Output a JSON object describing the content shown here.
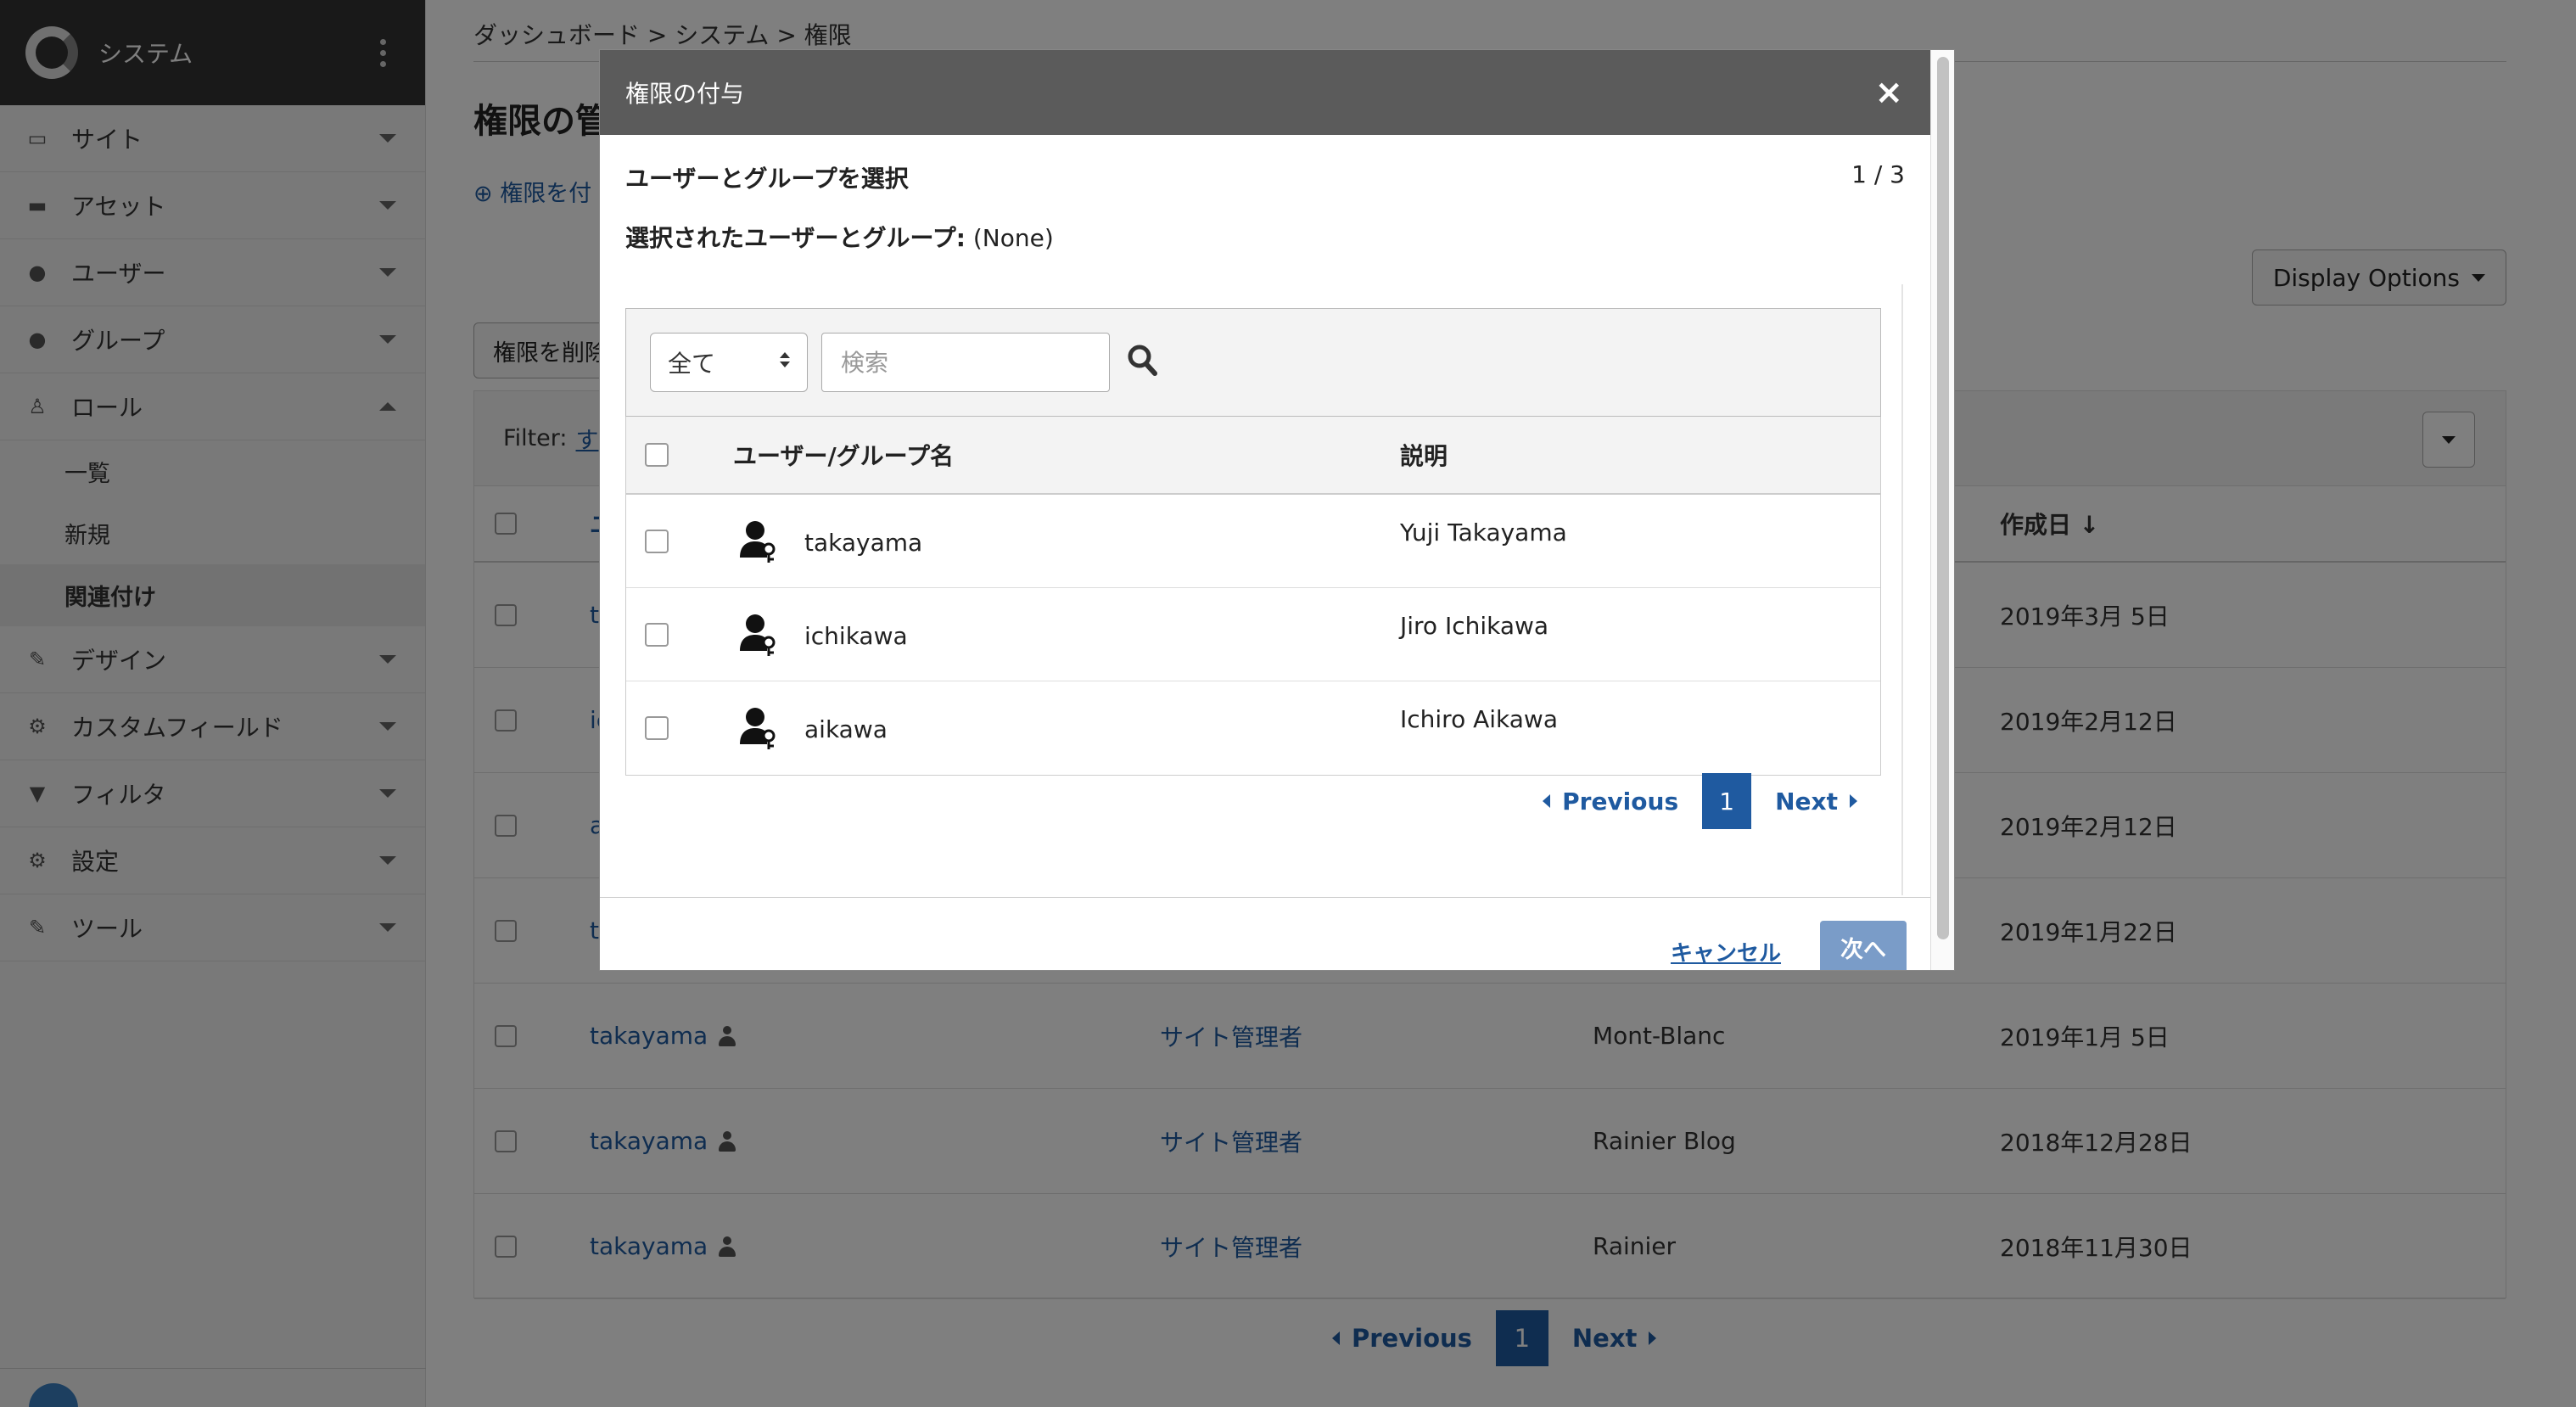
{
  "sidebar": {
    "title": "システム",
    "items": [
      {
        "label": "サイト",
        "icon": "sitemap-icon",
        "glyph": "▭"
      },
      {
        "label": "アセット",
        "icon": "briefcase-icon",
        "glyph": "▬"
      },
      {
        "label": "ユーザー",
        "icon": "user-icon",
        "glyph": "●"
      },
      {
        "label": "グループ",
        "icon": "users-icon",
        "glyph": "●"
      },
      {
        "label": "ロール",
        "icon": "sitemap-tree-icon",
        "glyph": "♙"
      },
      {
        "label": "デザイン",
        "icon": "design-icon",
        "glyph": "✎"
      },
      {
        "label": "カスタムフィールド",
        "icon": "cogs-icon",
        "glyph": "⚙"
      },
      {
        "label": "フィルタ",
        "icon": "filter-icon",
        "glyph": "▼"
      },
      {
        "label": "設定",
        "icon": "gear-icon",
        "glyph": "⚙"
      },
      {
        "label": "ツール",
        "icon": "wrench-icon",
        "glyph": "✎"
      }
    ],
    "role_sub": [
      "一覧",
      "新規",
      "関連付け"
    ]
  },
  "main": {
    "breadcrumb": "ダッシュボード  >  システム  >  権限",
    "page_title": "権限の管",
    "add_link": "⊕ 権限を付",
    "display_options": "Display Options",
    "remove_button": "権限を削除",
    "filter_label": "Filter:",
    "filter_link": "す",
    "header_user": "ユ",
    "header_date": "作成日 ↓",
    "rows": [
      {
        "user": "ta",
        "role": "",
        "site": "",
        "date": "2019年3月 5日"
      },
      {
        "user": "ic",
        "role": "",
        "site": "",
        "date": "2019年2月12日"
      },
      {
        "user": "a",
        "role": "",
        "site": "",
        "date": "2019年2月12日"
      },
      {
        "user": "ta",
        "role": "",
        "site": "",
        "date": "2019年1月22日"
      },
      {
        "user": "takayama",
        "role": "サイト管理者",
        "site": "Mont-Blanc",
        "date": "2019年1月 5日"
      },
      {
        "user": "takayama",
        "role": "サイト管理者",
        "site": "Rainier Blog",
        "date": "2018年12月28日"
      },
      {
        "user": "takayama",
        "role": "サイト管理者",
        "site": "Rainier",
        "date": "2018年11月30日"
      }
    ],
    "pager": {
      "prev": "Previous",
      "page": "1",
      "next": "Next"
    }
  },
  "modal": {
    "title": "権限の付与",
    "close": "×",
    "step_title": "ユーザーとグループを選択",
    "step": "1 / 3",
    "selected_label": "選択されたユーザーとグループ:",
    "selected_value": "(None)",
    "filter_select": "全て",
    "search_placeholder": "検索",
    "col_name": "ユーザー/グループ名",
    "col_desc": "説明",
    "rows": [
      {
        "name": "takayama",
        "desc": "Yuji Takayama"
      },
      {
        "name": "ichikawa",
        "desc": "Jiro Ichikawa"
      },
      {
        "name": "aikawa",
        "desc": "Ichiro Aikawa"
      }
    ],
    "pager": {
      "prev": "Previous",
      "page": "1",
      "next": "Next"
    },
    "cancel": "キャンセル",
    "next": "次へ"
  },
  "colors": {
    "accent": "#1f5aa0",
    "header": "#5b5b5b",
    "sidebar_header": "#333333"
  }
}
